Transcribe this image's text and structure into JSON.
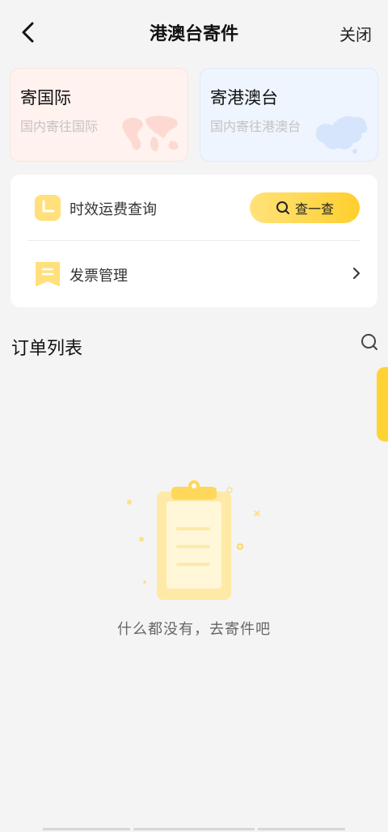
{
  "header": {
    "title": "港澳台寄件",
    "close_label": "关闭"
  },
  "cards": [
    {
      "title": "寄国际",
      "subtitle": "国内寄往国际"
    },
    {
      "title": "寄港澳台",
      "subtitle": "国内寄往港澳台"
    }
  ],
  "services": {
    "rate_query_label": "时效运费查询",
    "query_button_label": "查一查",
    "invoice_label": "发票管理"
  },
  "orders": {
    "section_title": "订单列表",
    "empty_text": "什么都没有，去寄件吧"
  },
  "colors": {
    "accent": "#ffd333",
    "background": "#f4f4f4",
    "intl_card_bg": "#fff2ef",
    "hk_card_bg": "#eef5ff"
  },
  "icons": [
    "back-arrow-icon",
    "world-map-icon",
    "china-map-icon",
    "clock-icon",
    "search-icon",
    "invoice-icon",
    "chevron-right-icon",
    "clipboard-icon"
  ]
}
